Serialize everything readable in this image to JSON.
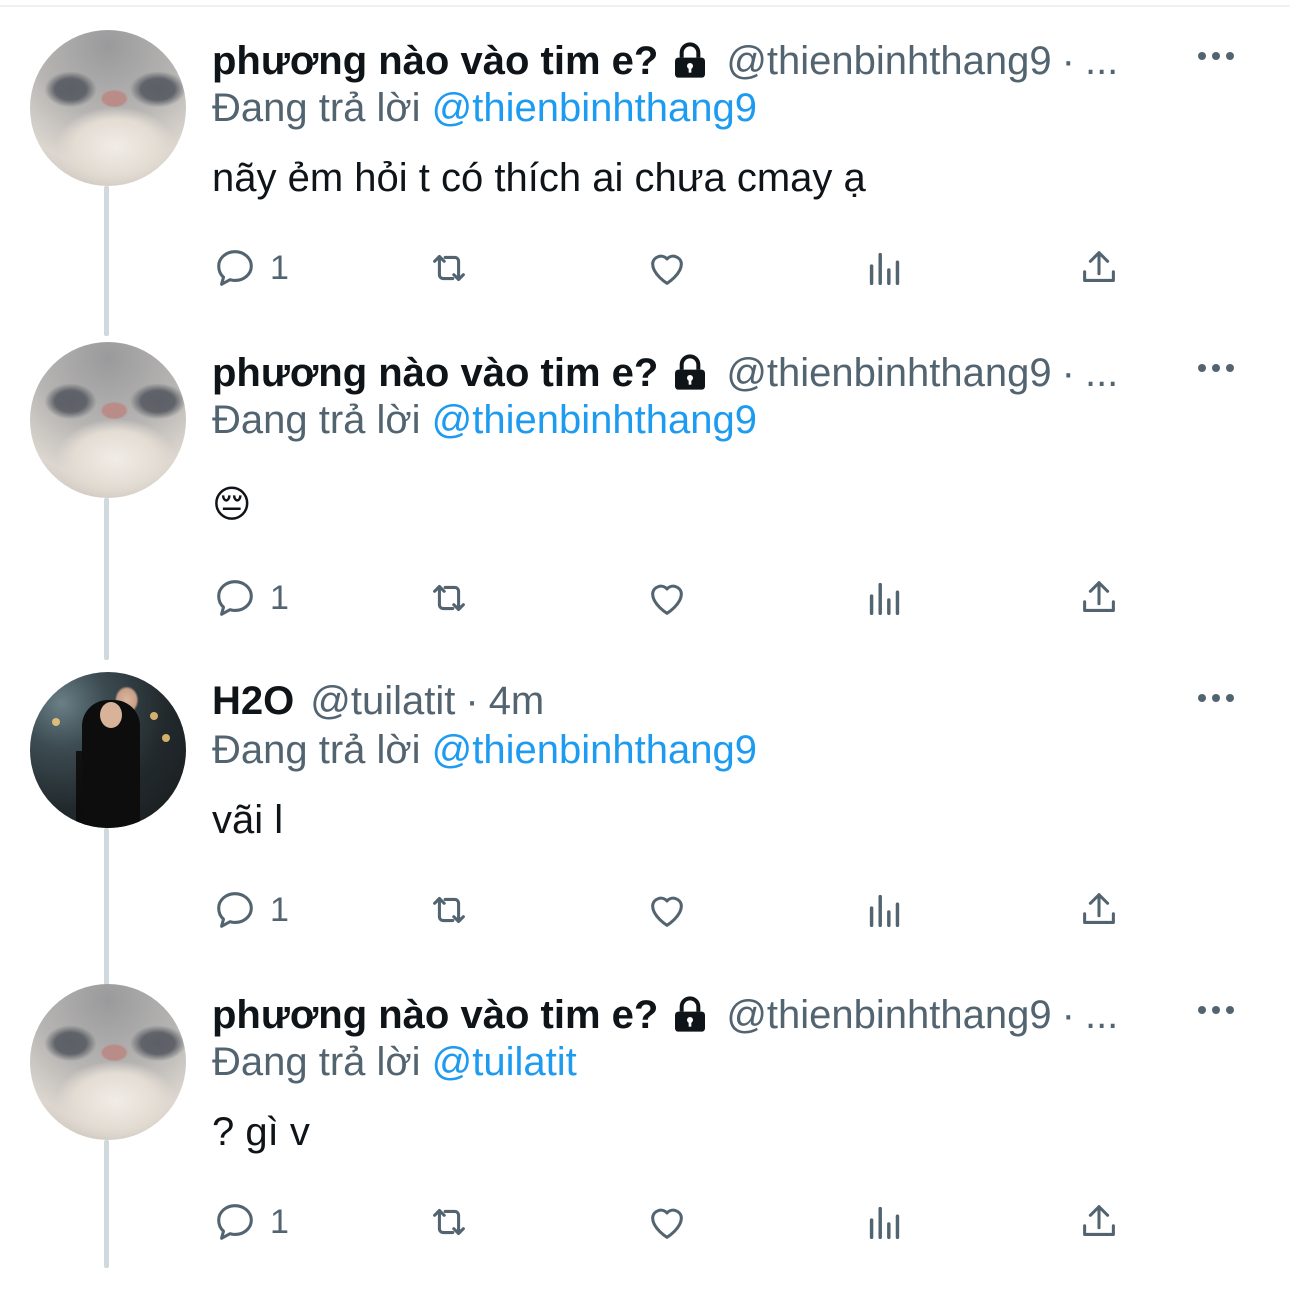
{
  "tweets": [
    {
      "avatar": "cat-avatar",
      "name": "phương nào vào tim e?",
      "protected_icon": "lock-icon",
      "handle": "@thienbinhthang9",
      "separator": "·",
      "meta": "...",
      "replying_label": "Đang trả lời",
      "replying_to": "@thienbinhthang9",
      "text": "nãy ẻm hỏi t có thích ai chưa cmay ạ",
      "reply_count": "1"
    },
    {
      "avatar": "cat-avatar",
      "name": "phương nào vào tim e?",
      "protected_icon": "lock-icon",
      "handle": "@thienbinhthang9",
      "separator": "·",
      "meta": "...",
      "replying_label": "Đang trả lời",
      "replying_to": "@thienbinhthang9",
      "text": "😔",
      "reply_count": "1"
    },
    {
      "avatar": "girl-avatar",
      "name": "H2O",
      "handle": "@tuilatit",
      "separator": "·",
      "meta": "4m",
      "replying_label": "Đang trả lời",
      "replying_to": "@thienbinhthang9",
      "text": "vãi l",
      "reply_count": "1"
    },
    {
      "avatar": "cat-avatar",
      "name": "phương nào vào tim e?",
      "protected_icon": "lock-icon",
      "handle": "@thienbinhthang9",
      "separator": "·",
      "meta": "...",
      "replying_label": "Đang trả lời",
      "replying_to": "@tuilatit",
      "text": "? gì v",
      "reply_count": "1"
    }
  ],
  "action_icons": [
    "reply-icon",
    "retweet-icon",
    "like-icon",
    "views-icon",
    "share-icon"
  ],
  "colors": {
    "text": "#0f1419",
    "secondary": "#536471",
    "mention": "#1d9bf0",
    "thread_line": "#cfd9de"
  }
}
